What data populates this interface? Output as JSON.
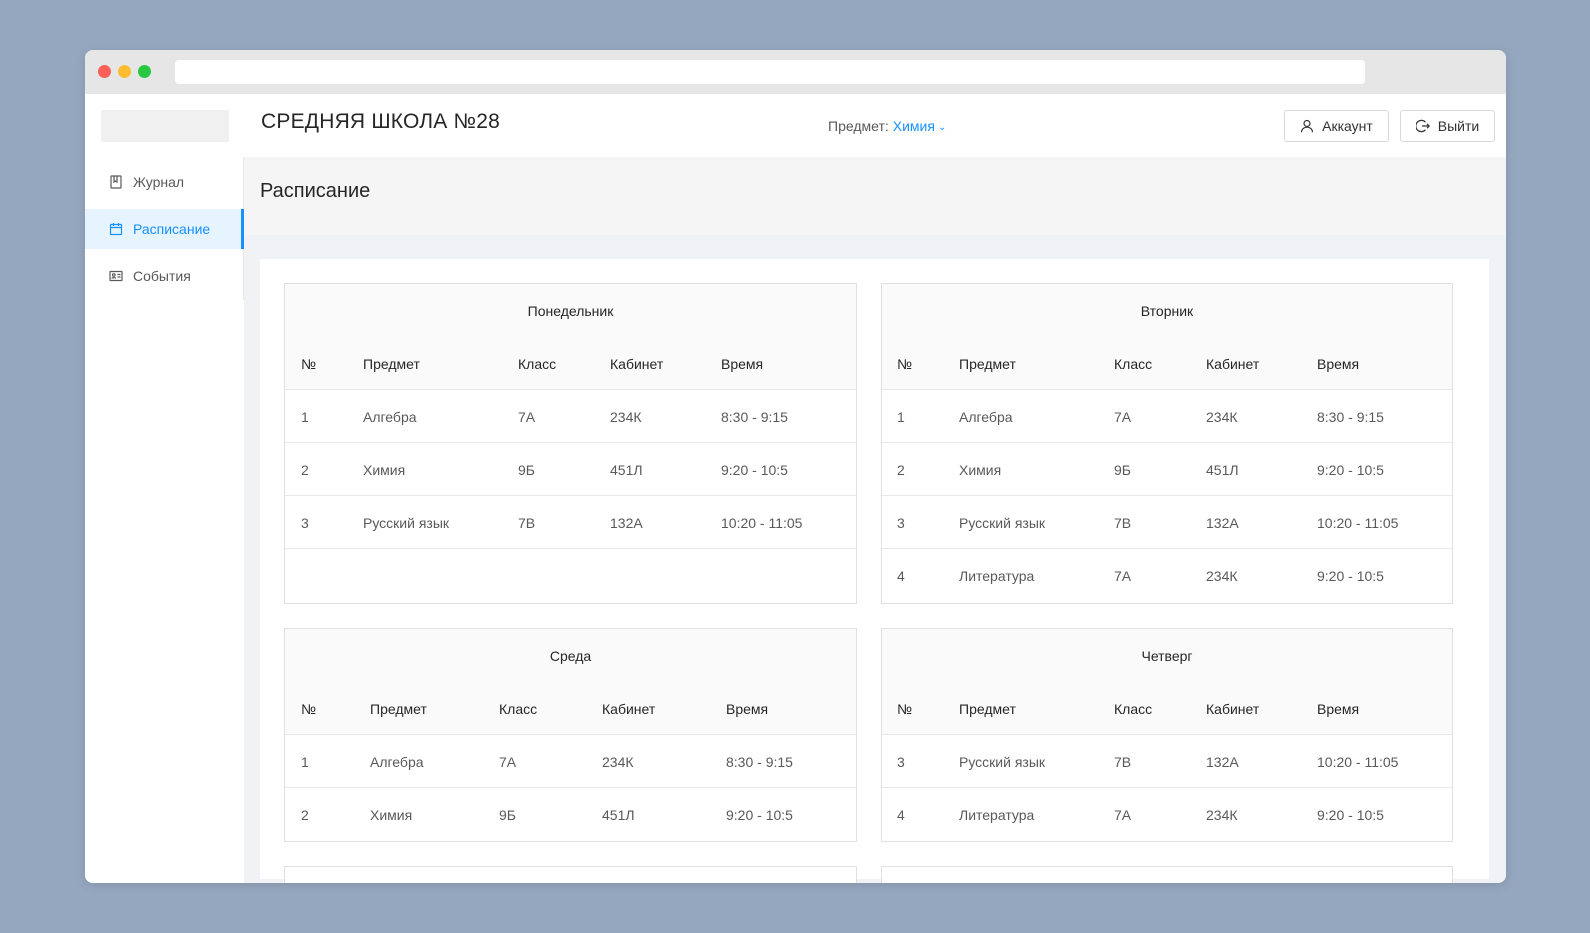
{
  "app": {
    "title": "СРЕДНЯЯ ШКОЛА №28",
    "subject_label": "Предмет:",
    "subject_value": "Химия",
    "account_label": "Аккаунт",
    "logout_label": "Выйти"
  },
  "sidebar": {
    "items": [
      {
        "label": "Журнал",
        "icon": "book-icon"
      },
      {
        "label": "Расписание",
        "icon": "calendar-icon",
        "active": true
      },
      {
        "label": "События",
        "icon": "id-card-icon"
      }
    ]
  },
  "page": {
    "title": "Расписание"
  },
  "columns": [
    "№",
    "Предмет",
    "Класс",
    "Кабинет",
    "Время"
  ],
  "days": [
    {
      "name": "Понедельник",
      "rows": [
        [
          "1",
          "Алгебра",
          "7А",
          "234К",
          "8:30 - 9:15"
        ],
        [
          "2",
          "Химия",
          "9Б",
          "451Л",
          "9:20 - 10:5"
        ],
        [
          "3",
          "Русский язык",
          "7В",
          "132А",
          "10:20 - 11:05"
        ]
      ]
    },
    {
      "name": "Вторник",
      "rows": [
        [
          "1",
          "Алгебра",
          "7А",
          "234К",
          "8:30 - 9:15"
        ],
        [
          "2",
          "Химия",
          "9Б",
          "451Л",
          "9:20 - 10:5"
        ],
        [
          "3",
          "Русский язык",
          "7В",
          "132А",
          "10:20 - 11:05"
        ],
        [
          "4",
          "Литература",
          "7А",
          "234К",
          "9:20 - 10:5"
        ]
      ]
    },
    {
      "name": "Среда",
      "rows": [
        [
          "1",
          "Алгебра",
          "7А",
          "234К",
          "8:30 - 9:15"
        ],
        [
          "2",
          "Химия",
          "9Б",
          "451Л",
          "9:20 - 10:5"
        ]
      ]
    },
    {
      "name": "Четверг",
      "rows": [
        [
          "3",
          "Русский язык",
          "7В",
          "132А",
          "10:20 - 11:05"
        ],
        [
          "4",
          "Литература",
          "7А",
          "234К",
          "9:20 - 10:5"
        ]
      ]
    }
  ]
}
